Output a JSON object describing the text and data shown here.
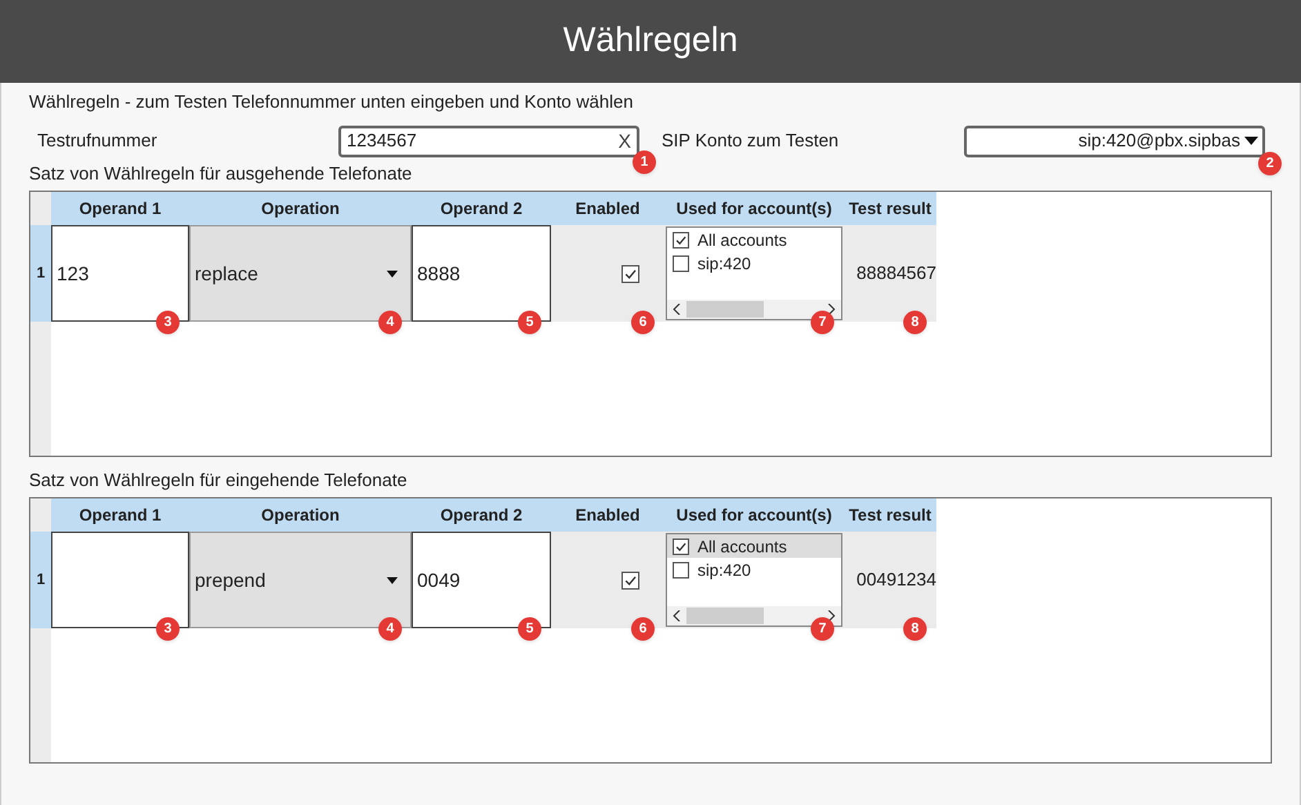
{
  "window": {
    "title": "Wählregeln"
  },
  "intro": "Wählregeln - zum Testen Telefonnummer unten eingeben und Konto wählen",
  "test_number": {
    "label": "Testrufnummer",
    "value": "1234567",
    "clear": "X",
    "callout": "1"
  },
  "test_account": {
    "label": "SIP Konto zum Testen",
    "value": "sip:420@pbx.sipbas",
    "callout": "2"
  },
  "rule_sets": [
    {
      "title": "Satz von Wählregeln für ausgehende Telefonate",
      "columns": [
        "Operand 1",
        "Operation",
        "Operand 2",
        "Enabled",
        "Used for account(s)",
        "Test result"
      ],
      "rows": [
        {
          "number": "1",
          "operand_1": "123",
          "operation": "replace",
          "operand_2": "8888",
          "enabled": true,
          "accounts": [
            {
              "label": "All accounts",
              "checked": true,
              "selected": false
            },
            {
              "label": "sip:420",
              "checked": false,
              "selected": false
            }
          ],
          "test_result": "88884567"
        }
      ],
      "callouts": [
        "3",
        "4",
        "5",
        "6",
        "7",
        "8"
      ]
    },
    {
      "title": "Satz von Wählregeln für eingehende Telefonate",
      "columns": [
        "Operand 1",
        "Operation",
        "Operand 2",
        "Enabled",
        "Used for account(s)",
        "Test result"
      ],
      "rows": [
        {
          "number": "1",
          "operand_1": "",
          "operation": "prepend",
          "operand_2": "0049",
          "enabled": true,
          "accounts": [
            {
              "label": "All accounts",
              "checked": true,
              "selected": true
            },
            {
              "label": "sip:420",
              "checked": false,
              "selected": false
            }
          ],
          "test_result": "00491234"
        }
      ],
      "callouts": [
        "3",
        "4",
        "5",
        "6",
        "7",
        "8"
      ]
    }
  ]
}
